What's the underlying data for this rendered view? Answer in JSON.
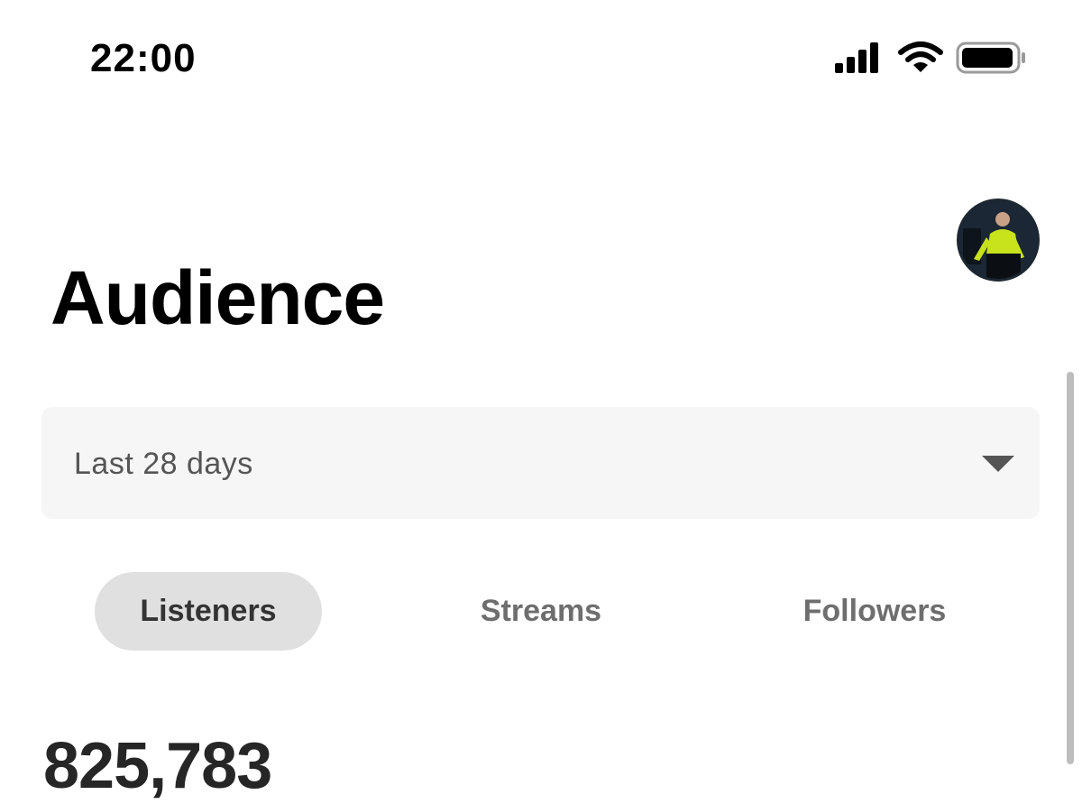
{
  "status_bar": {
    "time": "22:00",
    "icons": [
      "signal-icon",
      "wifi-icon",
      "battery-icon"
    ]
  },
  "header": {
    "title": "Audience",
    "avatar": "artist-avatar"
  },
  "filter": {
    "selected": "Last 28 days",
    "icon": "caret-down-icon"
  },
  "tabs": [
    {
      "label": "Listeners",
      "active": true
    },
    {
      "label": "Streams",
      "active": false
    },
    {
      "label": "Followers",
      "active": false
    }
  ],
  "metric": {
    "value": "825,783"
  },
  "colors": {
    "background": "#ffffff",
    "dropdown_bg": "#f6f6f6",
    "active_tab_bg": "#e0e0e0",
    "inactive_tab_text": "#6e6e6e",
    "avatar_shirt": "#c8e21c"
  }
}
